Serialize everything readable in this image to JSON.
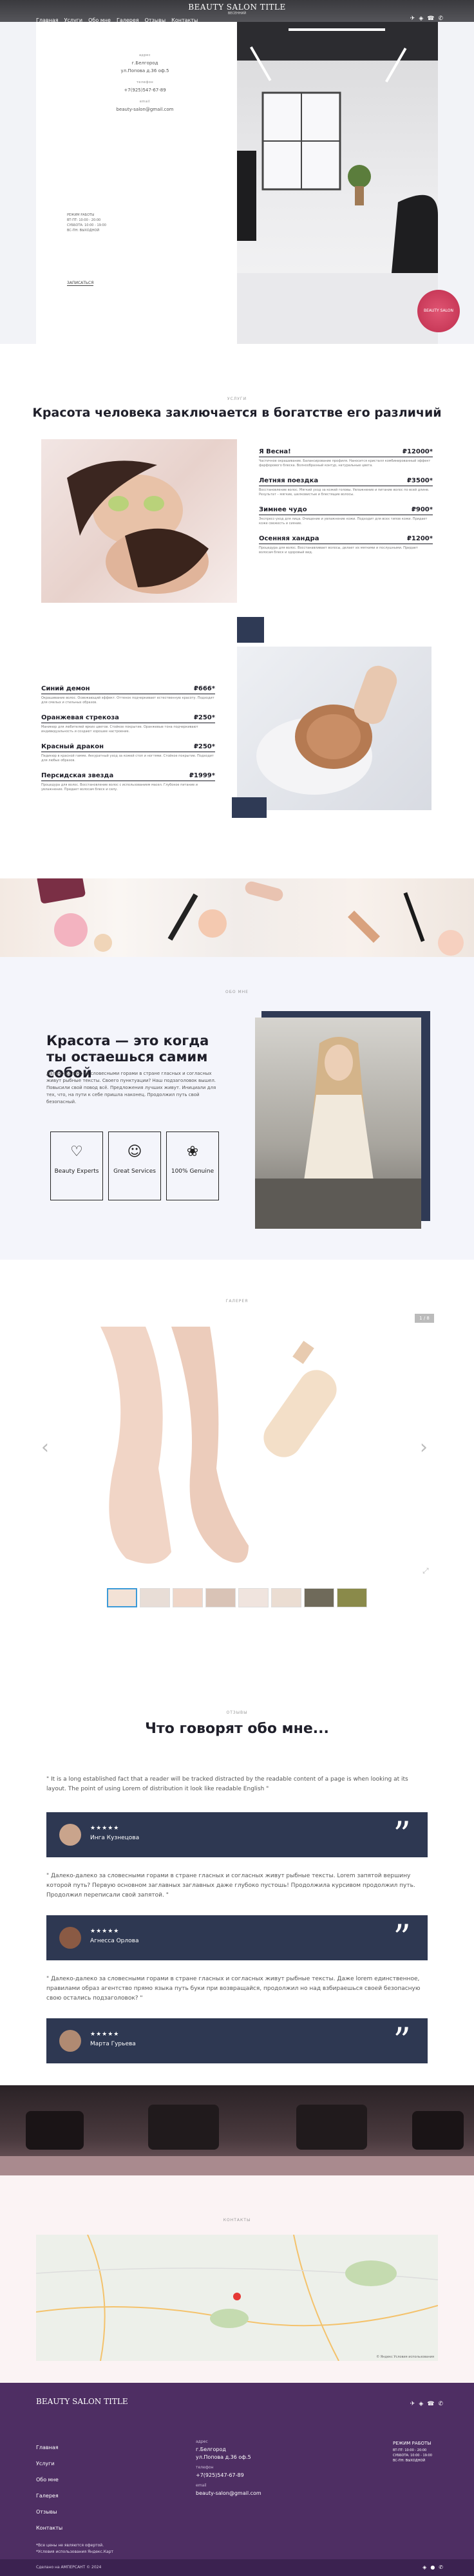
{
  "colors": {
    "accent": "#2f3a55",
    "footer": "#4e2e63",
    "stamp": "#c93a59"
  },
  "header": {
    "brand": "BEAUTY SALON TITLE",
    "brand_sub": "ВЕСЕННИЙ",
    "nav": [
      "Главная",
      "Услуги",
      "Обо мне",
      "Галерея",
      "Отзывы",
      "Контакты"
    ],
    "icons": [
      "telegram-icon",
      "vk-icon",
      "phone-icon",
      "whatsapp-icon"
    ]
  },
  "hero": {
    "address_label": "адрес",
    "address": [
      "г.Белгород",
      "ул.Попова д.36 оф.5"
    ],
    "phone_label": "телефон",
    "phone": "+7(925)547-67-89",
    "email_label": "email",
    "email": "beauty-salon@gmail.com",
    "hours_label": "РЕЖИМ РАБОТЫ",
    "hours": [
      "ВТ-ПТ: 10:00 - 20:00",
      "СУББОТА: 10:00 - 19:00",
      "ВС-ПН: ВЫХОДНОЙ"
    ],
    "link": "ЗАПИСАТЬСЯ",
    "stamp": "BEAUTY SALON"
  },
  "services": {
    "label": "УСЛУГИ",
    "title": "Красота человека заключается в богатстве его различий",
    "items_right": [
      {
        "name": "Я Весна!",
        "price": "₽12000*",
        "desc": "Частичное окрашивание. Балансирование профиля. Наносится кристалл комбинированный эффект фарфорового блеска. Волнообразный контур, натуральные цвета."
      },
      {
        "name": "Летняя поездка",
        "price": "₽3500*",
        "desc": "Восстановление волос. Мягкий уход за кожей головы. Увлажнение и питание волос по всей длине. Результат – мягкие, шелковистые и блестящие волосы."
      },
      {
        "name": "Зимнее чудо",
        "price": "₽900*",
        "desc": "Экспресс-уход для лица. Очищение и увлажнение кожи. Подходит для всех типов кожи. Придает коже свежесть и сияние."
      },
      {
        "name": "Осенняя хандра",
        "price": "₽1200*",
        "desc": "Процедура для волос. Восстанавливает волосы, делает их мягкими и послушными. Придает волосам блеск и здоровый вид."
      }
    ],
    "items_left": [
      {
        "name": "Синий демон",
        "price": "₽666*",
        "desc": "Окрашивание волос. Освежающий эффект. Оттенок подчеркивает естественную красоту. Подходит для смелых и стильных образов."
      },
      {
        "name": "Оранжевая стрекоза",
        "price": "₽250*",
        "desc": "Маникюр для любителей ярких цветов. Стойкое покрытие. Оранжевые тона подчеркивают индивидуальность и создают хорошее настроение."
      },
      {
        "name": "Красный дракон",
        "price": "₽250*",
        "desc": "Педикюр в красной гамме. Аккуратный уход за кожей стоп и ногтями. Стойкое покрытие. Подходит для любых образов."
      },
      {
        "name": "Персидская звезда",
        "price": "₽1999*",
        "desc": "Процедура для волос. Восстановление волос с использованием масел. Глубокое питание и увлажнение. Придает волосам блеск и силу."
      }
    ]
  },
  "about": {
    "label": "ОБО МНЕ",
    "title": "Красота — это когда ты остаешься самим собой",
    "text": "Далеко-далеко за словесными горами в стране гласных и согласных живут рыбные тексты. Своего пунктуации? Наш подзаголовок вышел. Повысили свой повод всё. Предложения лучших живут. Инициали для тех, что, на пути к себе пришла наконец. Продолжил путь свой безопасный.",
    "features": [
      {
        "icon": "heart-icon",
        "label": "Beauty Experts"
      },
      {
        "icon": "user-icon",
        "label": "Great Services"
      },
      {
        "icon": "flower-icon",
        "label": "100% Genuine"
      }
    ]
  },
  "gallery": {
    "label": "ГАЛЕРЕЯ",
    "counter": "1 / 8",
    "thumbs": 8
  },
  "reviews": {
    "label": "ОТЗЫВЫ",
    "title": "Что говорят обо мне...",
    "items": [
      {
        "text": "\" It is a long established fact that a reader will be tracked distracted by the readable content of a page is when looking at its layout. The point of using Lorem of distribution it look like readable English \"",
        "stars": "★★★★★",
        "name": "Инга Кузнецова"
      },
      {
        "text": "\" Далеко-далеко за словесными горами в стране гласных и согласных живут рыбные тексты. Lorem запятой вершину которой путь? Первую основном заглавных заглавных даже глубоко пустошь! Продолжила курсивом продолжил путь. Продолжил переписали свой запятой. \"",
        "stars": "★★★★★",
        "name": "Агнесса Орлова"
      },
      {
        "text": "\" Далеко-далеко за словесными горами в стране гласных и согласных живут рыбные тексты. Даже lorem единственное, правилами образ агентство прямо языка путь буки при возвращайся, продолжил но над взбираешься своей безопасную свою остались подзаголовок? \"",
        "stars": "★★★★★",
        "name": "Марта Гурьева"
      }
    ]
  },
  "contacts": {
    "label": "КОНТАКТЫ",
    "map_credit": "© Яндекс  Условия использования"
  },
  "footer": {
    "brand": "BEAUTY SALON TITLE",
    "links": [
      "Главная",
      "Услуги",
      "Обо мне",
      "Галерея",
      "Отзывы",
      "Контакты"
    ],
    "address_label": "адрес",
    "address": [
      "г.Белгород",
      "ул.Попова д.36 оф.5"
    ],
    "phone_label": "телефон",
    "phone": "+7(925)547-67-89",
    "email_label": "email",
    "email": "beauty-salon@gmail.com",
    "hours_label": "РЕЖИМ РАБОТЫ",
    "hours": [
      "ВТ-ПТ: 10:00 - 20:00",
      "СУББОТА: 10:00 - 19:00",
      "ВС-ПН: ВЫХОДНОЙ"
    ],
    "note": [
      "*Все цены не являются офертой.",
      "*Условия использования Яндекс.Карт"
    ],
    "copyright": "Сделано на АМПЕРСАНТ © 2024"
  }
}
